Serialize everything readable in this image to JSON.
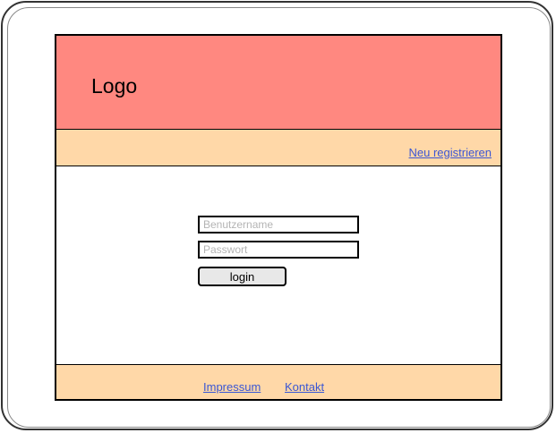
{
  "header": {
    "logo_text": "Logo",
    "background_color": "#ff8880"
  },
  "topbar": {
    "register_link": "Neu registrieren",
    "background_color": "#ffd8a8"
  },
  "login_form": {
    "username_placeholder": "Benutzername",
    "username_value": "",
    "password_placeholder": "Passwort",
    "password_value": "",
    "login_button_label": "login"
  },
  "footer": {
    "links": [
      "Impressum",
      "Kontakt"
    ],
    "background_color": "#ffd8a8"
  },
  "colors": {
    "link": "#3a56d4"
  }
}
